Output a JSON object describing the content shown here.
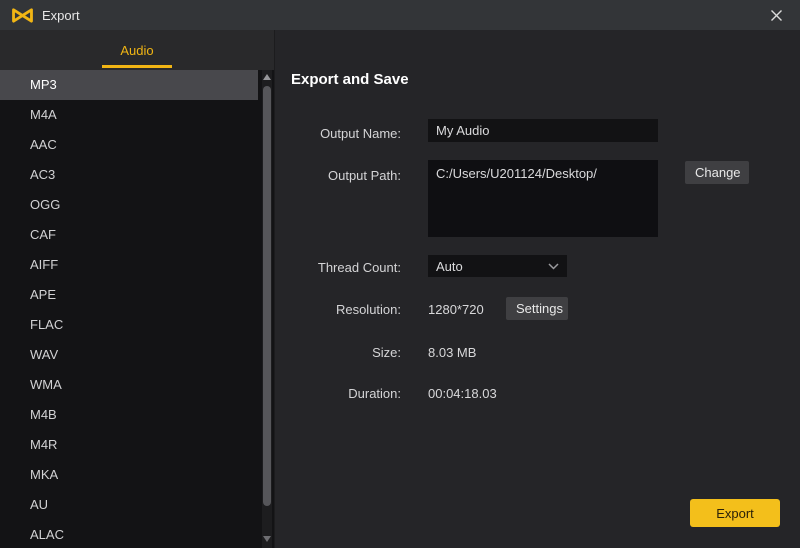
{
  "titlebar": {
    "title": "Export"
  },
  "sidebar": {
    "tab_label": "Audio",
    "selected_format": "MP3",
    "formats": [
      "MP3",
      "M4A",
      "AAC",
      "AC3",
      "OGG",
      "CAF",
      "AIFF",
      "APE",
      "FLAC",
      "WAV",
      "WMA",
      "M4B",
      "M4R",
      "MKA",
      "AU",
      "ALAC"
    ]
  },
  "main": {
    "heading": "Export and Save",
    "output_name": {
      "label": "Output Name:",
      "value": "My Audio"
    },
    "output_path": {
      "label": "Output Path:",
      "value": "C:/Users/U201124/Desktop/",
      "change_button": "Change"
    },
    "thread_count": {
      "label": "Thread Count:",
      "value": "Auto"
    },
    "resolution": {
      "label": "Resolution:",
      "value": "1280*720",
      "settings_button": "Settings"
    },
    "size": {
      "label": "Size:",
      "value": "8.03 MB"
    },
    "duration": {
      "label": "Duration:",
      "value": "00:04:18.03"
    },
    "export_button": "Export"
  },
  "colors": {
    "accent": "#f1b514",
    "export_button_bg": "#f3bf1b",
    "selected_row_bg": "#48484c"
  }
}
